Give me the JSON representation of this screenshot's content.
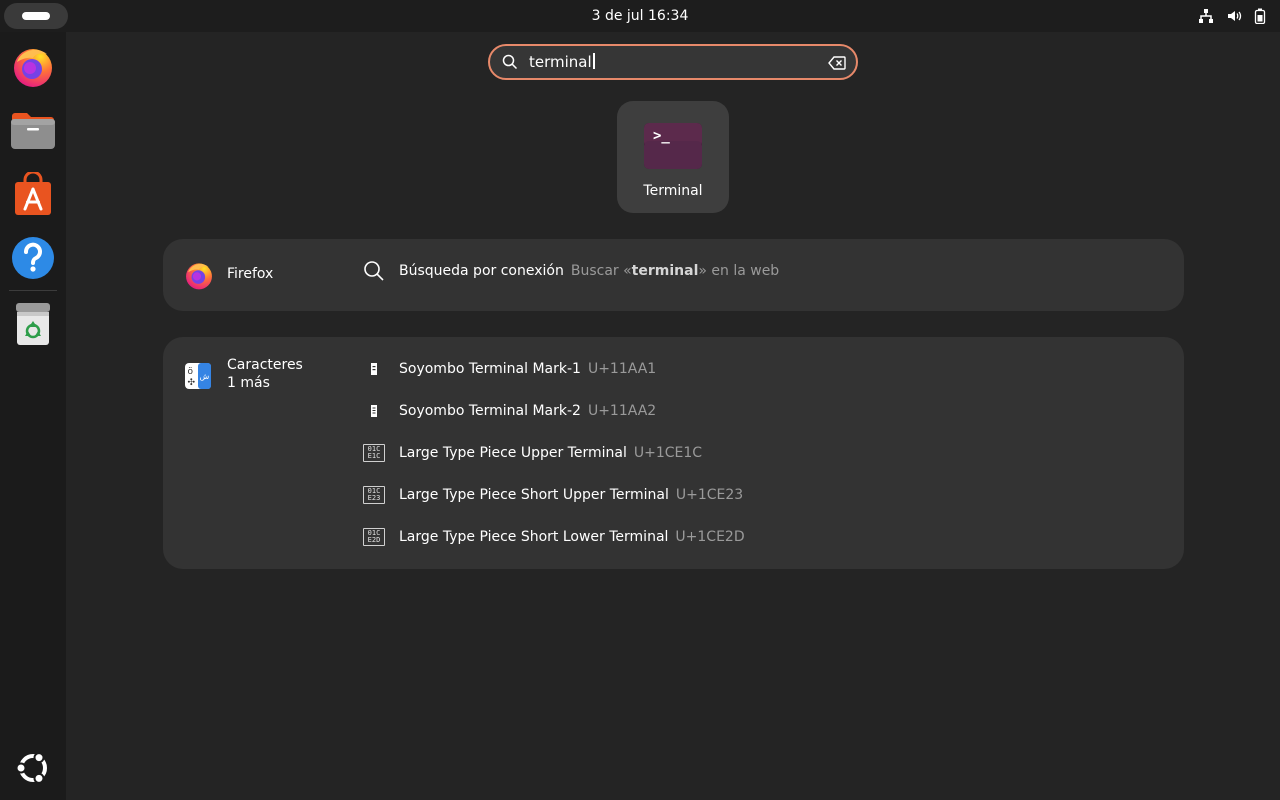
{
  "topbar": {
    "clock": "3 de jul  16:34",
    "tray_icons": [
      "network-icon",
      "volume-icon",
      "battery-icon"
    ]
  },
  "dock": {
    "apps": [
      "firefox-icon",
      "files-icon",
      "app-center-icon",
      "help-icon",
      "trash-icon"
    ],
    "show_apps": "ubuntu-logo-icon"
  },
  "search": {
    "query": "terminal"
  },
  "app_result": {
    "label": "Terminal",
    "icon_prompt": ">_"
  },
  "web_provider": {
    "name": "Firefox",
    "result_title": "Búsqueda por conexión",
    "result_desc_prefix": "Buscar «",
    "result_desc_term": "terminal",
    "result_desc_suffix": "» en la web"
  },
  "char_provider": {
    "name": "Caracteres",
    "more": "1 más",
    "results": [
      {
        "name": "Soyombo Terminal Mark-1",
        "code": "U+11AA1",
        "glyph": "soyombo-mark-1"
      },
      {
        "name": "Soyombo Terminal Mark-2",
        "code": "U+11AA2",
        "glyph": "soyombo-mark-2"
      },
      {
        "name": "Large Type Piece Upper Terminal",
        "code": "U+1CE1C",
        "glyph_hex": [
          "01C",
          "E1C"
        ]
      },
      {
        "name": "Large Type Piece Short Upper Terminal",
        "code": "U+1CE23",
        "glyph_hex": [
          "01C",
          "E23"
        ]
      },
      {
        "name": "Large Type Piece Short Lower Terminal",
        "code": "U+1CE2D",
        "glyph_hex": [
          "01C",
          "E2D"
        ]
      }
    ]
  },
  "colors": {
    "accent": "#e7896a",
    "background": "#242424",
    "panel": "#333333",
    "terminal_icon": "#5a2a4a"
  }
}
